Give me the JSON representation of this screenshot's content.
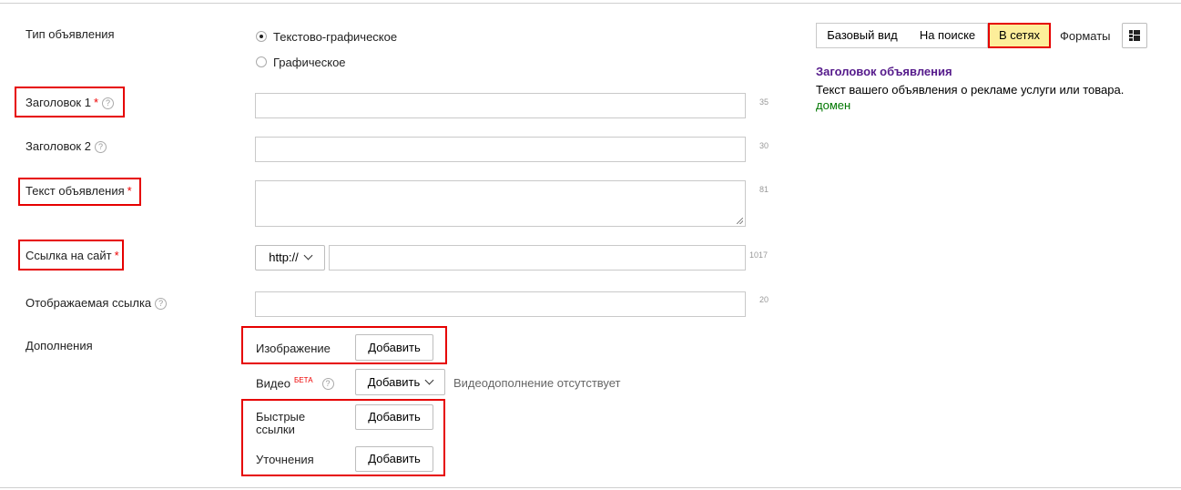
{
  "form": {
    "ad_type": {
      "label": "Тип объявления",
      "options": [
        {
          "label": "Текстово-графическое",
          "selected": true
        },
        {
          "label": "Графическое",
          "selected": false
        }
      ]
    },
    "title1": {
      "label": "Заголовок 1",
      "required_mark": "*",
      "help": "?",
      "value": "",
      "counter": "35"
    },
    "title2": {
      "label": "Заголовок 2",
      "help": "?",
      "value": "",
      "counter": "30"
    },
    "text": {
      "label": "Текст объявления",
      "required_mark": "*",
      "value": "",
      "counter": "81"
    },
    "link": {
      "label": "Ссылка на сайт",
      "required_mark": "*",
      "protocol": "http://",
      "value": "",
      "counter": "1017"
    },
    "display_link": {
      "label": "Отображаемая ссылка",
      "help": "?",
      "value": "",
      "counter": "20"
    },
    "extras": {
      "label": "Дополнения",
      "image": {
        "label": "Изображение",
        "button": "Добавить"
      },
      "video": {
        "label": "Видео",
        "badge": "БЕТА",
        "help": "?",
        "button": "Добавить",
        "status": "Видеодополнение отсутствует"
      },
      "sitelinks": {
        "label": "Быстрые ссылки",
        "button": "Добавить"
      },
      "callouts": {
        "label": "Уточнения",
        "button": "Добавить"
      }
    }
  },
  "preview": {
    "tabs": [
      "Базовый вид",
      "На поиске",
      "В сетях"
    ],
    "active_tab": "В сетях",
    "formats_label": "Форматы",
    "formats_icon": "grid-layout-icon",
    "ad_title": "Заголовок объявления",
    "ad_text": "Текст вашего объявления о рекламе услуги или товара.",
    "ad_domain": "домен"
  },
  "colors": {
    "highlight_box": "#e60000",
    "active_tab_bg": "#fdee9a",
    "preview_title": "#551a8b",
    "preview_domain": "#007700",
    "required_star": "#e00000",
    "beta_badge": "#e00000"
  }
}
